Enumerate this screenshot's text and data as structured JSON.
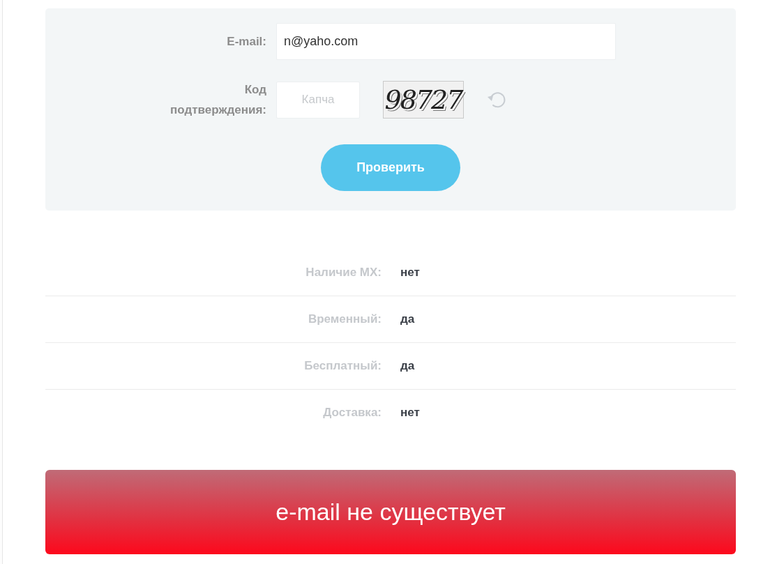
{
  "form": {
    "fields": [
      {
        "kind": "text",
        "label": "E-mail:",
        "value": "n@yaho.com"
      },
      {
        "kind": "captcha",
        "label": "Код подтверждения:",
        "placeholder": "Капча",
        "captcha_text": "98727"
      }
    ],
    "submit_button": "Проверить"
  },
  "results": [
    {
      "label": "Наличие MX:",
      "value": "нет"
    },
    {
      "label": "Временный:",
      "value": "да"
    },
    {
      "label": "Бесплатный:",
      "value": "да"
    },
    {
      "label": "Доставка:",
      "value": "нет"
    }
  ],
  "verdict": {
    "kind": "error",
    "text": "e-mail не существует"
  }
}
